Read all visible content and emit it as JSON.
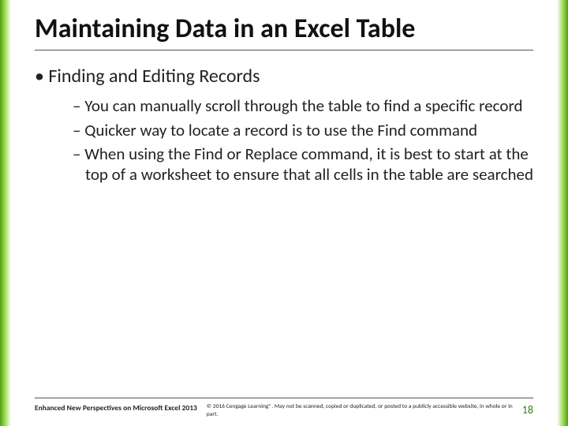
{
  "title": "Maintaining Data in an Excel Table",
  "bullets": {
    "level1": "Finding and Editing Records",
    "level2": [
      "You can manually scroll through the table to find a specific record",
      "Quicker way to locate a record is to use the Find command",
      "When using the Find or Replace command, it is best to start at the top of a worksheet to ensure that all cells in the table are searched"
    ]
  },
  "footer": {
    "left": "Enhanced New Perspectives on Microsoft Excel 2013",
    "center": "© 2016 Cengage Learning®. May not be scanned, copied or duplicated, or posted to a publicly accessible website, in whole or in part.",
    "page": "18"
  }
}
